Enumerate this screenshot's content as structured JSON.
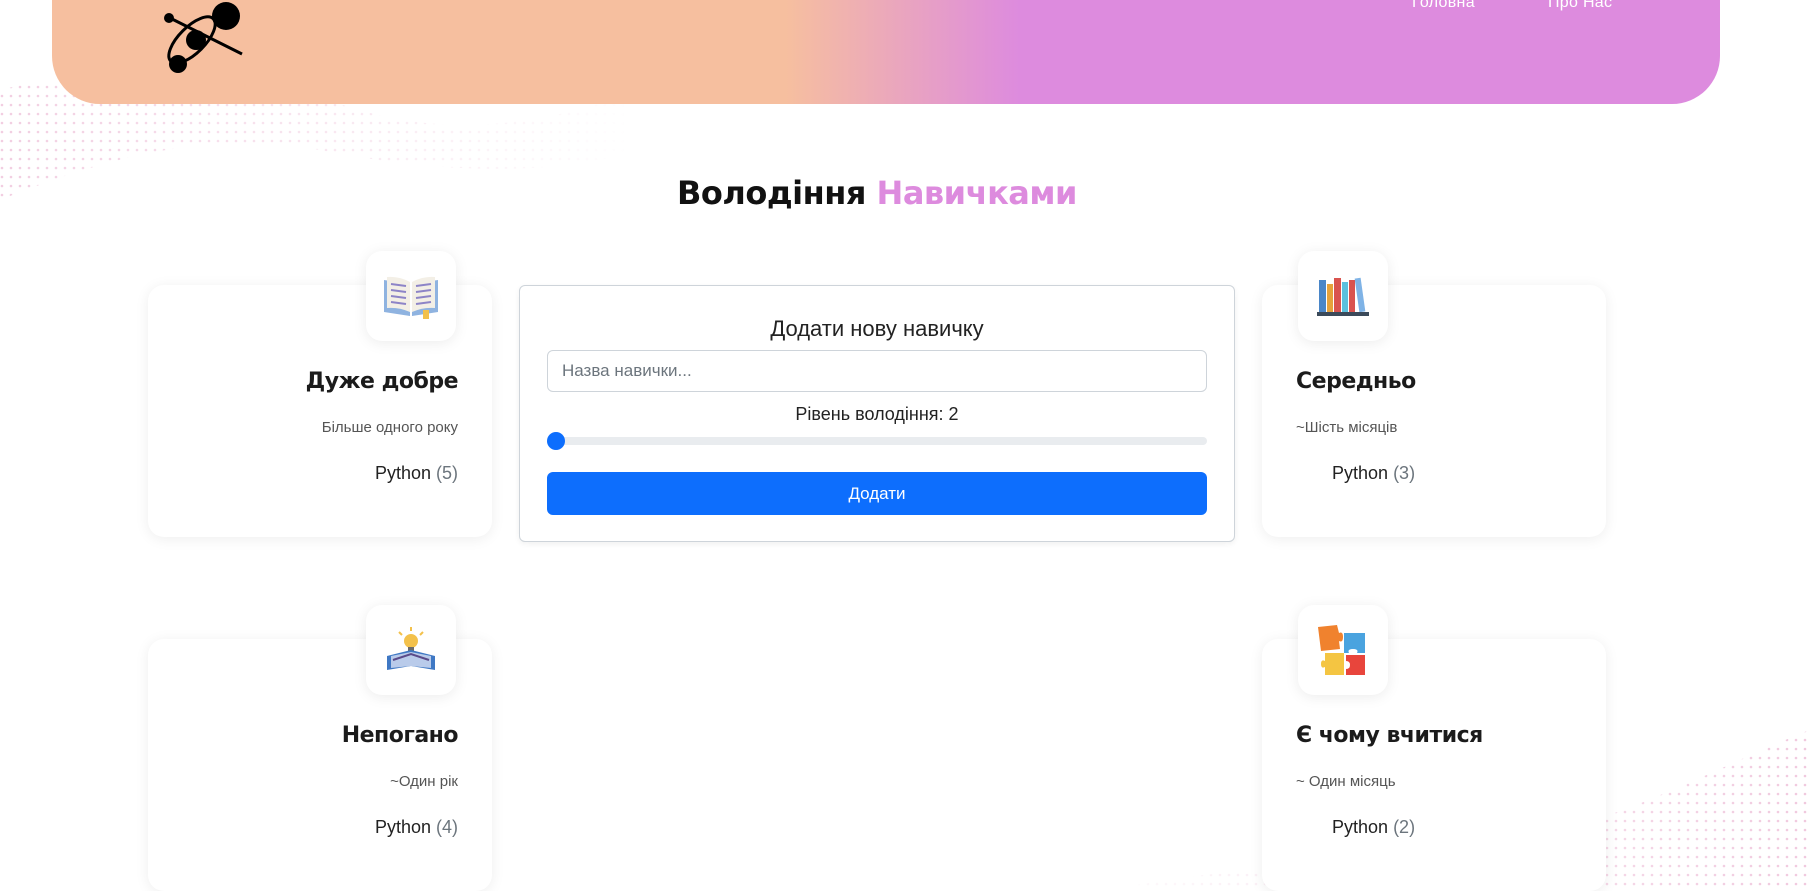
{
  "nav": {
    "home_label": "Головна",
    "about_label": "Про Нас"
  },
  "title": {
    "main": "Володіння",
    "accent": "Навичками"
  },
  "colors": {
    "header_left": "#f6bf9f",
    "header_right": "#dd8bde",
    "accent": "#dd8bde",
    "primary_button": "#0d6efd"
  },
  "cards": [
    {
      "icon": "open-book-icon",
      "title": "Дуже добре",
      "subtitle": "Більше одного року",
      "skill": "Python",
      "count": "(5)"
    },
    {
      "icon": "bookshelf-icon",
      "title": "Середньо",
      "subtitle": "~Шість місяців",
      "skill": "Python",
      "count": "(3)"
    },
    {
      "icon": "idea-book-icon",
      "title": "Непогано",
      "subtitle": "~Один рік",
      "skill": "Python",
      "count": "(4)"
    },
    {
      "icon": "puzzle-icon",
      "title": "Є чому вчитися",
      "subtitle": "~ Один місяць",
      "skill": "Python",
      "count": "(2)"
    }
  ],
  "form": {
    "title": "Додати нову навичку",
    "input_placeholder": "Назва навички...",
    "input_value": "",
    "level_label": "Рівень володіння: 2",
    "level_fraction": 0.0,
    "submit_label": "Додати"
  }
}
